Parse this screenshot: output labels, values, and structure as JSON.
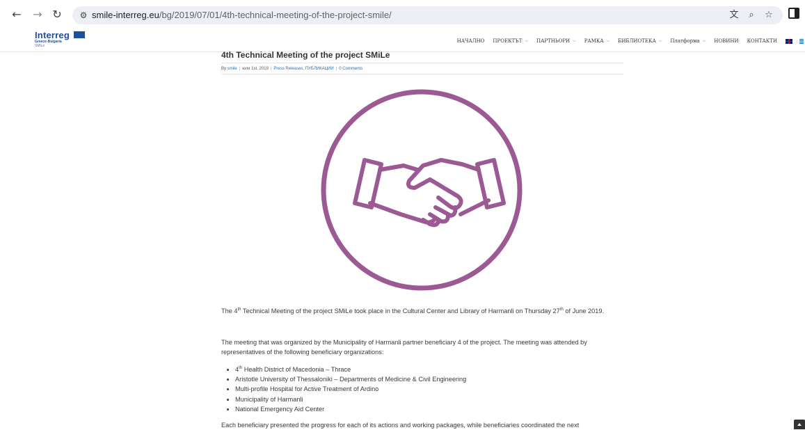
{
  "browser": {
    "back_icon": "arrow-left-icon",
    "forward_icon": "arrow-right-icon",
    "reload_icon": "reload-icon",
    "url_host": "smile-interreg.eu",
    "url_path": "/bg/2019/07/01/4th-technical-meeting-of-the-project-smile/"
  },
  "site": {
    "logo_main": "Interreg",
    "logo_sub": "Greece-Bulgaria",
    "logo_project": "SMiLe",
    "menu": [
      {
        "label": "НАЧАЛНО",
        "dropdown": false
      },
      {
        "label": "ПРОЕКТЪТ",
        "dropdown": true
      },
      {
        "label": "ПАРТНЬОРИ",
        "dropdown": true
      },
      {
        "label": "РАМКА",
        "dropdown": true
      },
      {
        "label": "БИБЛИОТЕКА",
        "dropdown": true
      },
      {
        "label": "Платформа",
        "dropdown": true
      },
      {
        "label": "НОВИНИ",
        "dropdown": false
      },
      {
        "label": "КОНТАКТИ",
        "dropdown": false
      }
    ]
  },
  "article": {
    "title": "4th Technical Meeting of the project SMiLe",
    "meta": {
      "by": "By",
      "author": "smile",
      "date": "юли 1st, 2019",
      "categories": "Press Releases, ПУБЛИКАЦИИ",
      "comments": "0 Comments"
    },
    "hero_color": "#9b5a94",
    "p1": {
      "a": "The 4",
      "sup1": "th",
      "b": " Technical Meeting of the project SMiLe took place in the Cultural Center and Library of Harmanli on Thursday 27",
      "sup2": "th",
      "c": " of June 2019."
    },
    "p2": "The meeting that was organized by the Municipality of Harmanli partner beneficiary 4 of the project. The meeting was attended by representatives of the following beneficiary organizations:",
    "list": {
      "first_a": "4",
      "first_sup": "th",
      "first_b": " Health District of Macedonia – Thrace",
      "items": [
        "Aristotle University of Thessaloniki – Departments of Medicine & Civil Engineering",
        "Multi-profile Hospital for Active Treatment of Ardino",
        "Municipality of Harmanli",
        "National Emergency Aid Center"
      ]
    },
    "p3": "Each beneficiary presented the progress for each of its actions and working packages, while beneficiaries coordinated the next"
  }
}
